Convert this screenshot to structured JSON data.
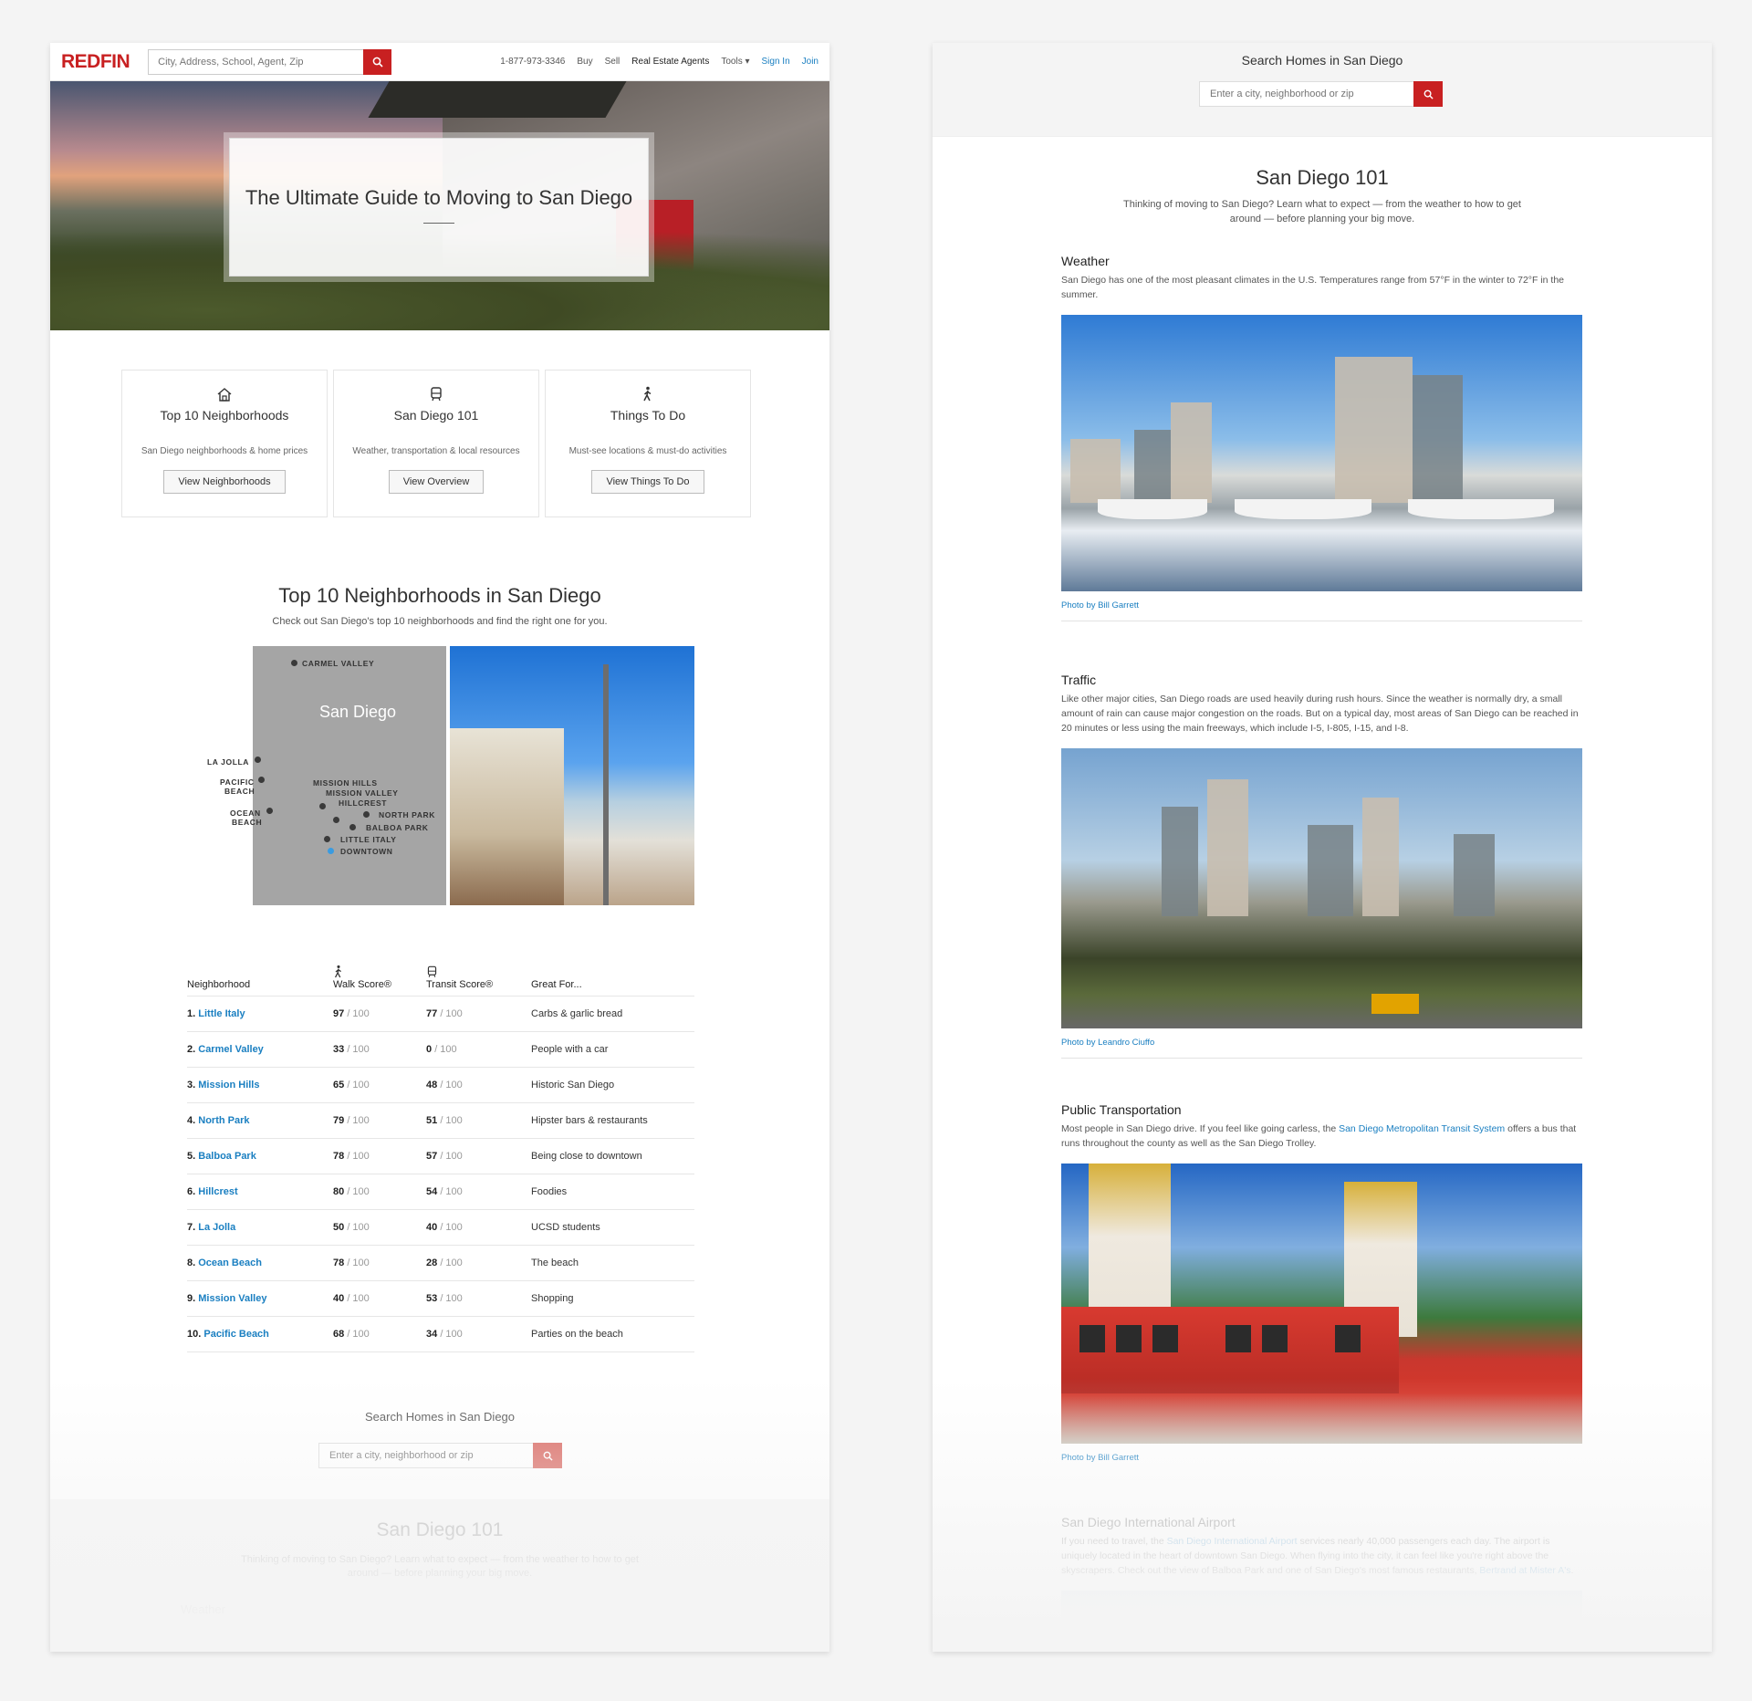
{
  "left": {
    "nav": {
      "logo": "REDFIN",
      "search_placeholder": "City, Address, School, Agent, Zip",
      "phone": "1-877-973-3346",
      "links": [
        "Buy",
        "Sell",
        "Real Estate Agents",
        "Tools ▾"
      ],
      "sign_in": "Sign In",
      "join": "Join"
    },
    "hero": {
      "title": "The Ultimate Guide to Moving to San Diego"
    },
    "cards": [
      {
        "icon": "house-icon",
        "title": "Top 10 Neighborhoods",
        "desc": "San Diego neighborhoods & home prices",
        "button": "View Neighborhoods"
      },
      {
        "icon": "bus-icon",
        "title": "San Diego 101",
        "desc": "Weather, transportation & local resources",
        "button": "View Overview"
      },
      {
        "icon": "walking-person-icon",
        "title": "Things To Do",
        "desc": "Must-see locations & must-do activities",
        "button": "View Things To Do"
      }
    ],
    "neighborhoods": {
      "title": "Top 10 Neighborhoods in San Diego",
      "subtitle": "Check out San Diego's top 10 neighborhoods and find the right one for you.",
      "map_title": "San Diego",
      "map_labels": [
        "CARMEL VALLEY",
        "LA JOLLA",
        "PACIFIC",
        "BEACH",
        "OCEAN",
        "BEACH",
        "MISSION HILLS",
        "MISSION VALLEY",
        "HILLCREST",
        "NORTH PARK",
        "BALBOA PARK",
        "LITTLE ITALY",
        "DOWNTOWN"
      ],
      "headers": [
        "Neighborhood",
        "Walk Score®",
        "Transit Score®",
        "Great For..."
      ],
      "score_suffix": "/ 100",
      "rows": [
        {
          "num": "1.",
          "name": "Little Italy",
          "walk": "97",
          "transit": "77",
          "great": "Carbs & garlic bread"
        },
        {
          "num": "2.",
          "name": "Carmel Valley",
          "walk": "33",
          "transit": "0",
          "great": "People with a car"
        },
        {
          "num": "3.",
          "name": "Mission Hills",
          "walk": "65",
          "transit": "48",
          "great": "Historic San Diego"
        },
        {
          "num": "4.",
          "name": "North Park",
          "walk": "79",
          "transit": "51",
          "great": "Hipster bars & restaurants"
        },
        {
          "num": "5.",
          "name": "Balboa Park",
          "walk": "78",
          "transit": "57",
          "great": "Being close to downtown"
        },
        {
          "num": "6.",
          "name": "Hillcrest",
          "walk": "80",
          "transit": "54",
          "great": "Foodies"
        },
        {
          "num": "7.",
          "name": "La Jolla",
          "walk": "50",
          "transit": "40",
          "great": "UCSD students"
        },
        {
          "num": "8.",
          "name": "Ocean Beach",
          "walk": "78",
          "transit": "28",
          "great": "The beach"
        },
        {
          "num": "9.",
          "name": "Mission Valley",
          "walk": "40",
          "transit": "53",
          "great": "Shopping"
        },
        {
          "num": "10.",
          "name": "Pacific Beach",
          "walk": "68",
          "transit": "34",
          "great": "Parties on the beach"
        }
      ]
    },
    "search": {
      "title": "Search Homes in San Diego",
      "placeholder": "Enter a city, neighborhood or zip"
    },
    "ghost": {
      "title": "San Diego 101",
      "line1": "Thinking of moving to San Diego? Learn what to expect — from the weather to how to get",
      "line2": "around — before planning your big move.",
      "weather": "Weather"
    }
  },
  "right": {
    "search": {
      "title": "Search Homes in San Diego",
      "placeholder": "Enter a city, neighborhood or zip"
    },
    "intro": {
      "title": "San Diego 101",
      "line1": "Thinking of moving to San Diego? Learn what to expect — from the weather to how to get",
      "line2": "around — before planning your big move."
    },
    "weather": {
      "title": "Weather",
      "text": "San Diego has one of the most pleasant climates in the U.S. Temperatures range from 57°F in the winter to 72°F in the summer.",
      "caption": "Photo by Bill Garrett"
    },
    "traffic": {
      "title": "Traffic",
      "text": "Like other major cities, San Diego roads are used heavily during rush hours. Since the weather is normally dry, a small amount of rain can cause major congestion on the roads. But on a typical day, most areas of San Diego can be reached in 20 minutes or less using the main freeways, which include I-5, I-805, I-15, and I-8.",
      "caption": "Photo by Leandro Ciuffo"
    },
    "transit": {
      "title": "Public Transportation",
      "text_before": "Most people in San Diego drive. If you feel like going carless, the ",
      "link": "San Diego Metropolitan Transit System",
      "text_after": " offers a bus that runs throughout the county as well as the San Diego Trolley.",
      "caption": "Photo by Bill Garrett"
    },
    "airport": {
      "title": "San Diego International Airport",
      "text_before": "If you need to travel, the ",
      "link": "San Diego International Airport",
      "text_after": " services nearly 40,000 passengers each day. The airport is uniquely located in the heart of downtown San Diego. When flying into the city, it can feel like you're right above the skyscrapers. Check out the view of Balboa Park and one of San Diego's most famous restaurants, ",
      "link2": "Bertrand at Mister A's",
      "text_end": "."
    }
  }
}
